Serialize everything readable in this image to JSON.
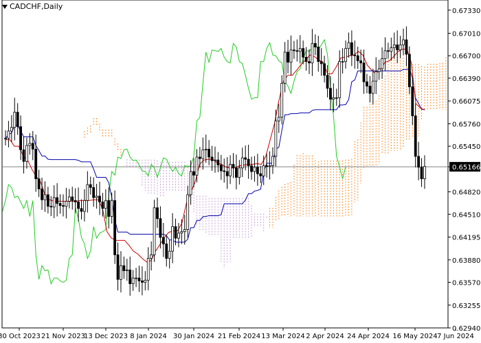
{
  "window": {
    "symbol_timeframe": "CADCHF,Daily"
  },
  "colors": {
    "background": "#ffffff",
    "candle": "#000000",
    "tenkan": "#cc0000",
    "kijun": "#0000aa",
    "chikou": "#22cc22",
    "cloud_bull": "#ff8c2a",
    "cloud_bear": "#c8a0d8",
    "price_line": "#808080",
    "label_bg": "#000000",
    "label_fg": "#ffffff"
  },
  "chart_data": {
    "type": "candlestick",
    "title": "CADCHF,Daily",
    "ylim": [
      0.6294,
      0.6747
    ],
    "current_price": "0.65166",
    "y_ticks": [
      "0.67330",
      "0.67010",
      "0.66700",
      "0.66390",
      "0.66075",
      "0.65760",
      "0.65450",
      "0.65166",
      "0.64820",
      "0.64510",
      "0.64195",
      "0.63880",
      "0.63570",
      "0.63255",
      "0.62940"
    ],
    "x_ticks": [
      "30 Oct 2023",
      "21 Nov 2023",
      "13 Dec 2023",
      "8 Jan 2024",
      "30 Jan 2024",
      "21 Feb 2024",
      "13 Mar 2024",
      "2 Apr 2024",
      "24 Apr 2024",
      "16 May 2024",
      "7 Jun 2024"
    ],
    "close": [
      0.6556,
      0.6566,
      0.6571,
      0.6592,
      0.6572,
      0.654,
      0.6524,
      0.6546,
      0.6549,
      0.6541,
      0.65,
      0.6486,
      0.6471,
      0.6478,
      0.6462,
      0.6461,
      0.6474,
      0.6466,
      0.6463,
      0.6462,
      0.6469,
      0.6475,
      0.647,
      0.6468,
      0.6459,
      0.6455,
      0.647,
      0.6492,
      0.6488,
      0.6474,
      0.6476,
      0.6468,
      0.6459,
      0.647,
      0.6448,
      0.647,
      0.6395,
      0.6361,
      0.638,
      0.6373,
      0.6374,
      0.6355,
      0.6363,
      0.6363,
      0.6359,
      0.6357,
      0.636,
      0.639,
      0.6395,
      0.646,
      0.6445,
      0.6419,
      0.641,
      0.639,
      0.64,
      0.6434,
      0.6418,
      0.6425,
      0.6427,
      0.643,
      0.6478,
      0.651,
      0.6505,
      0.653,
      0.6528,
      0.654,
      0.6541,
      0.653,
      0.6525,
      0.6526,
      0.6519,
      0.6511,
      0.651,
      0.6504,
      0.652,
      0.6515,
      0.6502,
      0.6515,
      0.6529,
      0.6527,
      0.6518,
      0.651,
      0.6516,
      0.6507,
      0.6504,
      0.6518,
      0.6517,
      0.6518,
      0.6531,
      0.658,
      0.6585,
      0.6632,
      0.6675,
      0.6661,
      0.6678,
      0.6677,
      0.6676,
      0.668,
      0.6668,
      0.6662,
      0.666,
      0.6687,
      0.6682,
      0.6662,
      0.6659,
      0.6643,
      0.6625,
      0.661,
      0.6612,
      0.6612,
      0.6662,
      0.6662,
      0.668,
      0.6688,
      0.6671,
      0.667,
      0.6663,
      0.666,
      0.6634,
      0.6628,
      0.6618,
      0.6635,
      0.6648,
      0.6652,
      0.6666,
      0.6677,
      0.6676,
      0.6681,
      0.6685,
      0.6678,
      0.6685,
      0.6692,
      0.6672,
      0.6627,
      0.6587,
      0.6531,
      0.6516,
      0.65,
      0.6517
    ],
    "tenkan_sen": [
      0.6554,
      0.6554,
      0.6545,
      0.6545,
      0.6532,
      0.6526,
      0.6513,
      0.6503,
      0.6495,
      0.6477,
      0.6471,
      0.6469,
      0.6469,
      0.6469,
      0.6469,
      0.6469,
      0.6469,
      0.647,
      0.647,
      0.647,
      0.6471,
      0.6471,
      0.6459,
      0.6427,
      0.6418,
      0.6415,
      0.6415,
      0.6415,
      0.6408,
      0.64,
      0.6396,
      0.639,
      0.6385,
      0.6387,
      0.64,
      0.6409,
      0.6419,
      0.6426,
      0.6428,
      0.6428,
      0.6439,
      0.6466,
      0.6481,
      0.6496,
      0.652,
      0.6526,
      0.6527,
      0.6527,
      0.6522,
      0.652,
      0.6516,
      0.6515,
      0.6515,
      0.6518,
      0.6519,
      0.652,
      0.652,
      0.6521,
      0.652,
      0.6531,
      0.6554,
      0.6577,
      0.6609,
      0.6635,
      0.6643,
      0.6643,
      0.665,
      0.6658,
      0.6664,
      0.6671,
      0.6669,
      0.6664,
      0.6661,
      0.6645,
      0.6645,
      0.6655,
      0.6667,
      0.6668,
      0.667,
      0.6671,
      0.6676,
      0.6671,
      0.6657,
      0.665,
      0.6645,
      0.6652,
      0.6661,
      0.6663,
      0.6669,
      0.6676,
      0.6679,
      0.6679,
      0.666,
      0.6604,
      0.6598,
      0.6595
    ]
  }
}
